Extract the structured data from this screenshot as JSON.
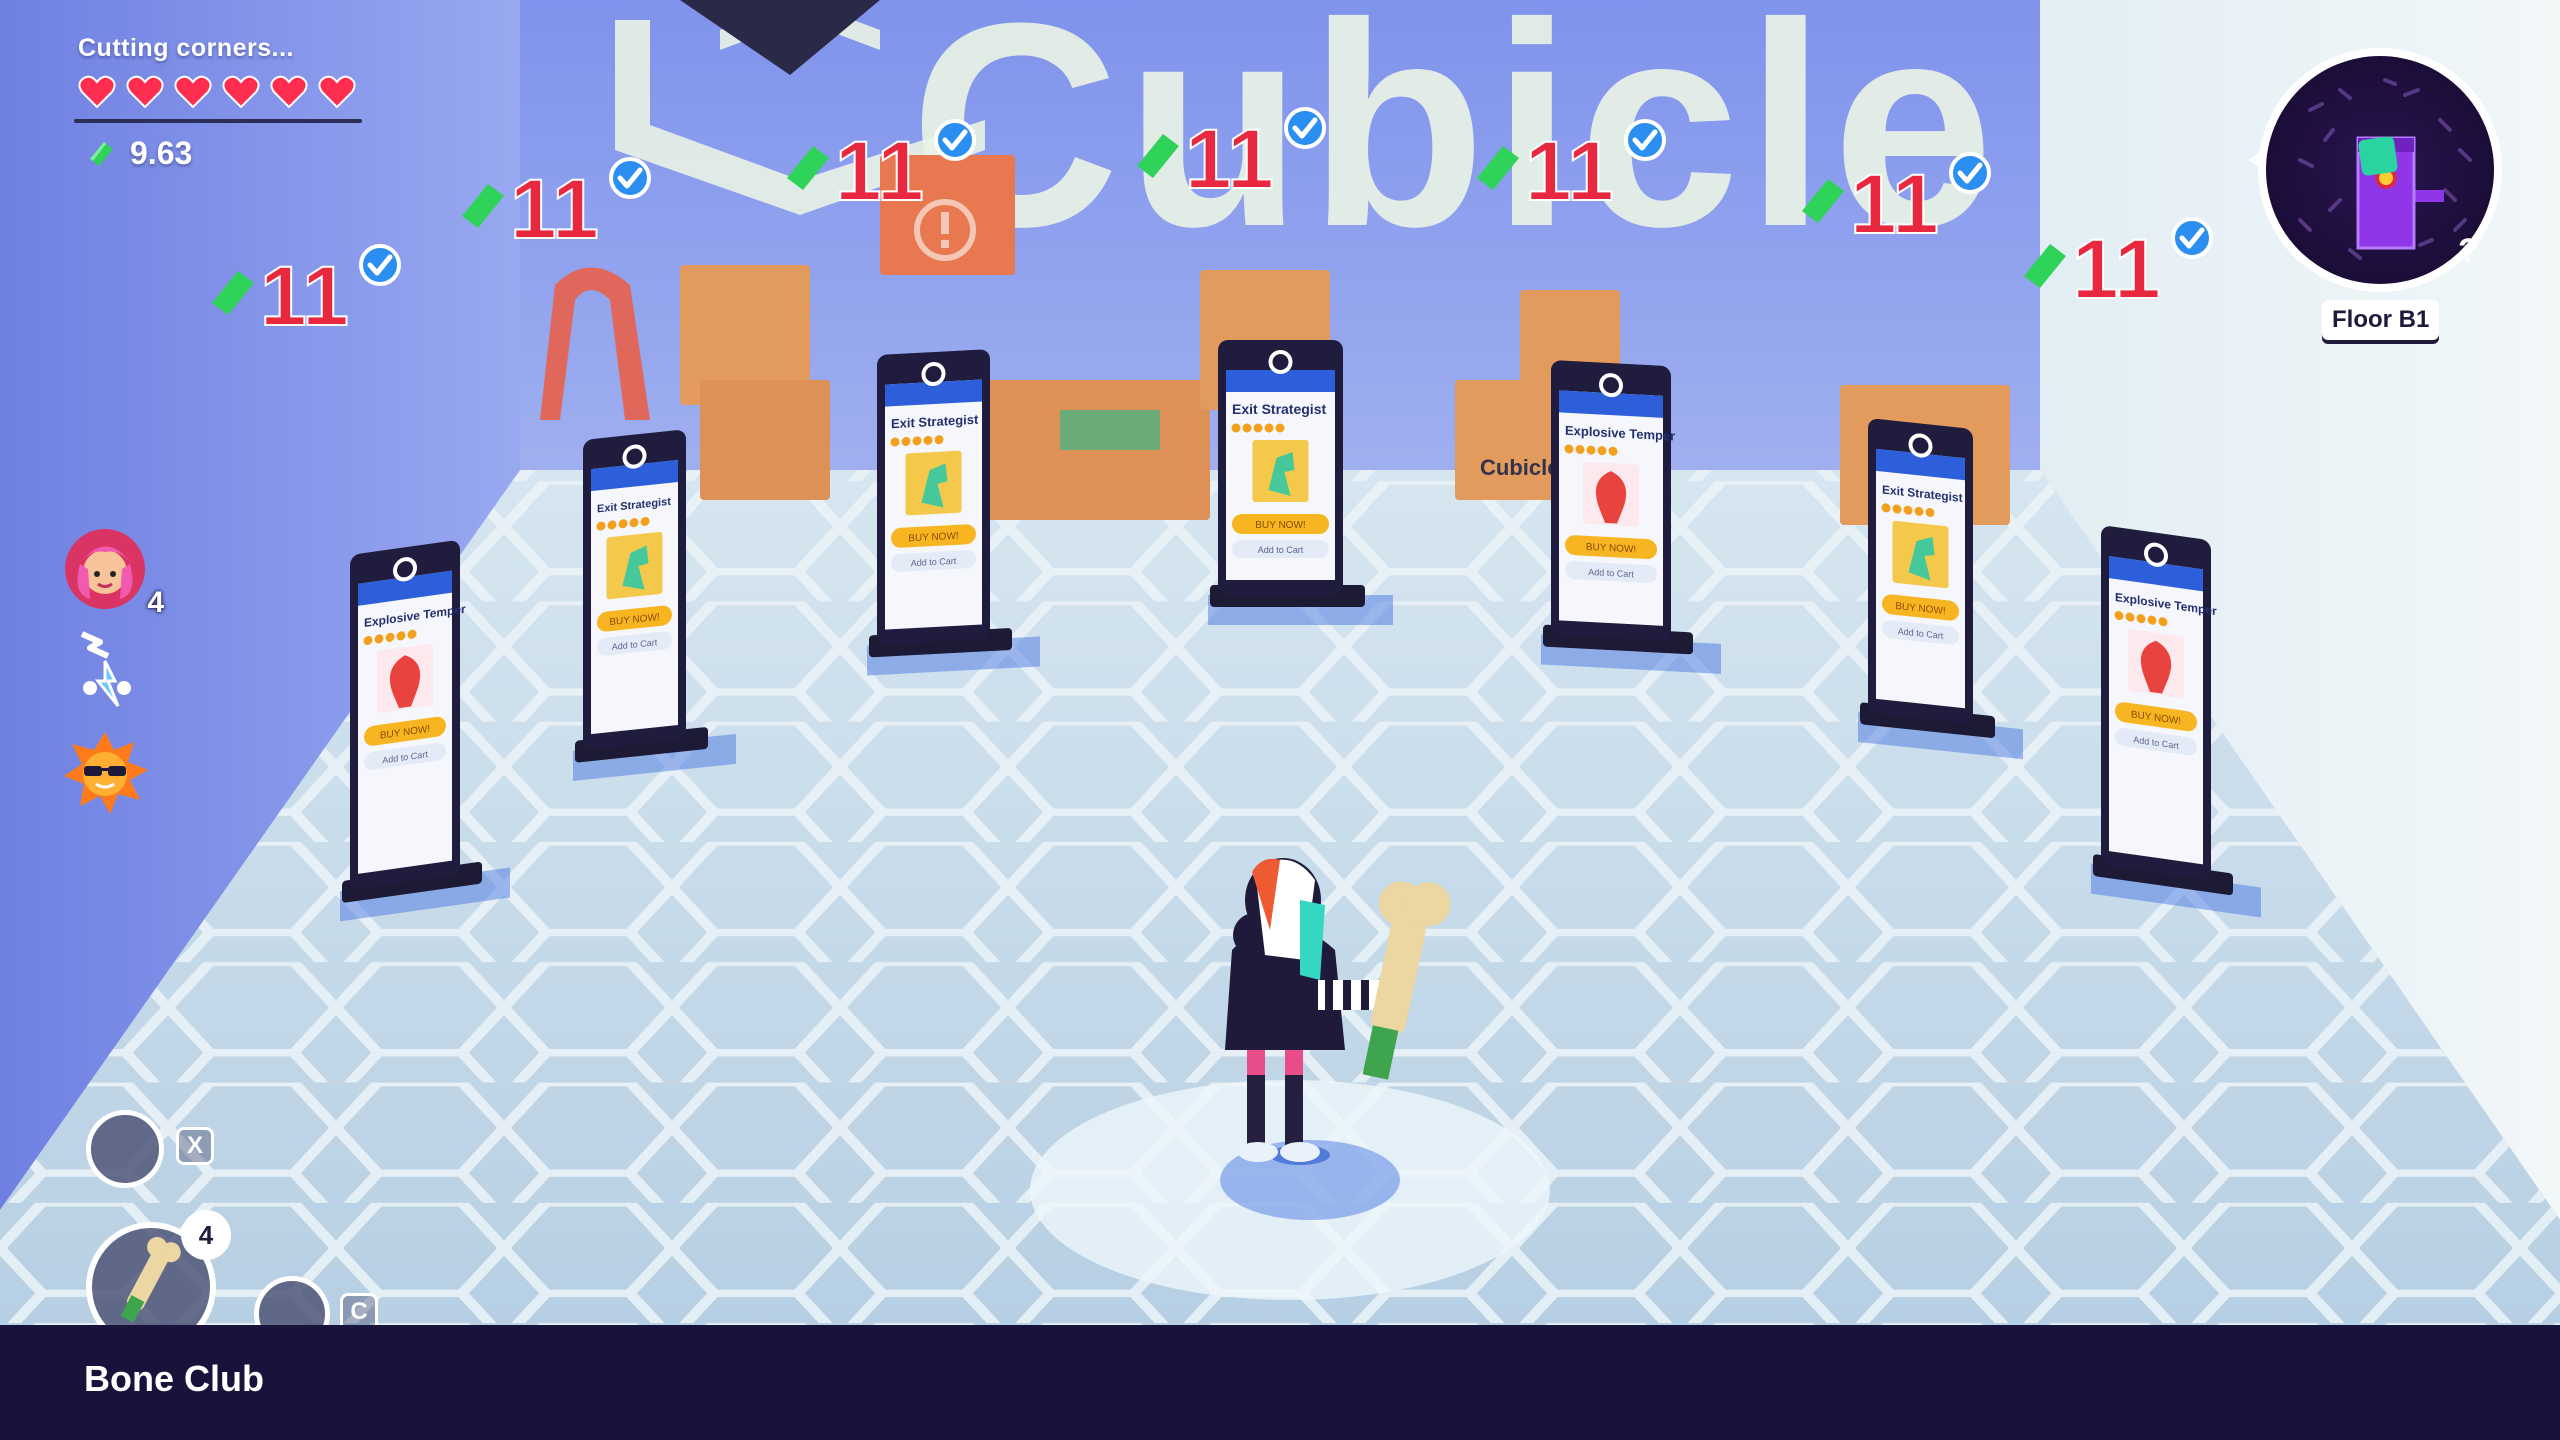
{
  "hud": {
    "status_text": "Cutting corners...",
    "hearts": 6,
    "money": "9.63",
    "buff_count": "4",
    "icons": [
      "heart-icon",
      "gem-icon",
      "character-portrait-icon",
      "lightning-buff-icon",
      "sunglasses-sun-buff-icon"
    ]
  },
  "controls": {
    "key_x": "X",
    "key_c": "C",
    "weapon_count": "4",
    "weapon_name": "Bone Club"
  },
  "minimap": {
    "floor_label": "Floor B1",
    "unknown_marker": "?"
  },
  "banner": {
    "text": "Cubicle"
  },
  "shop": {
    "items": [
      {
        "price": "11",
        "title": "Explosive Temper",
        "verified": true
      },
      {
        "price": "11",
        "title": "Exit Strategist",
        "verified": true
      },
      {
        "price": "11",
        "title": "Exit Strategist",
        "verified": true
      },
      {
        "price": "11",
        "title": "Exit Strategist",
        "verified": true
      },
      {
        "price": "11",
        "title": "Explosive Temper",
        "verified": true
      },
      {
        "price": "11",
        "title": "Exit Strategist",
        "verified": true
      },
      {
        "price": "11",
        "title": "Explosive Temper",
        "verified": true
      }
    ],
    "buy_label": "BUY NOW!",
    "cart_label": "Add to Cart",
    "box_brand": "Cubicle"
  },
  "colors": {
    "price": "#e8283f",
    "gem": "#2fd35a",
    "verified": "#2a8ff0",
    "wall": "#7d8ee6",
    "floor": "#c7dcec",
    "bar": "#17133a"
  }
}
